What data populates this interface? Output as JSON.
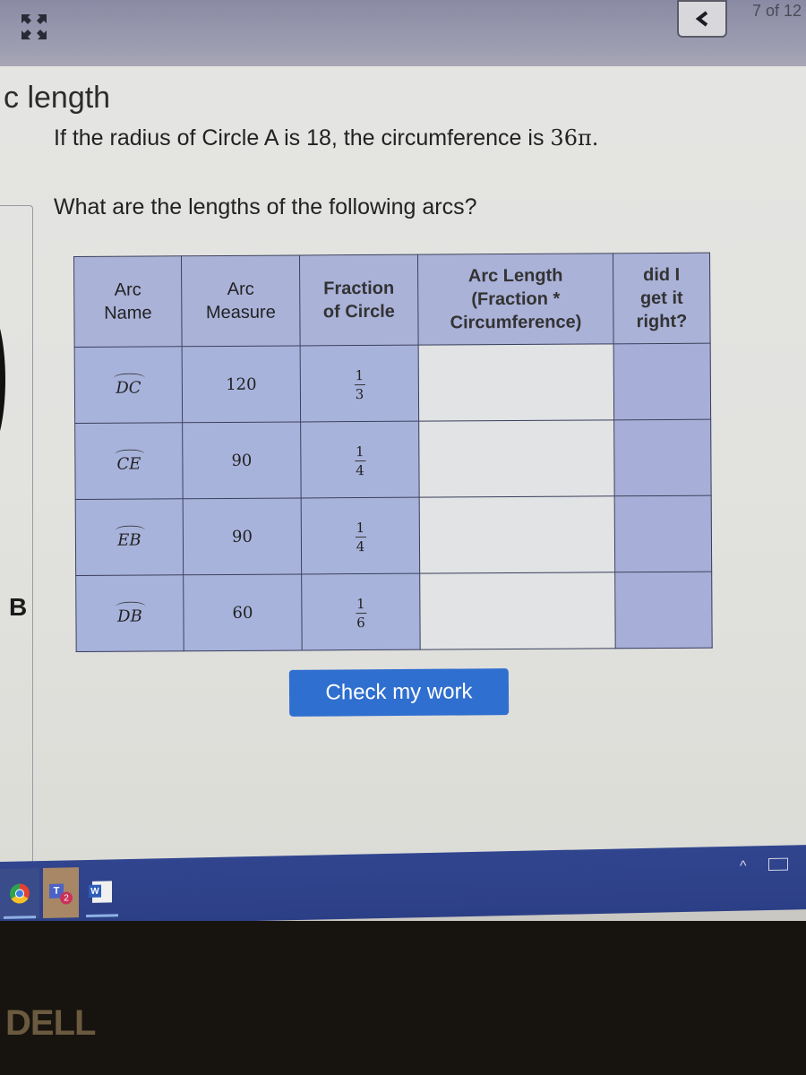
{
  "topbar": {
    "expand_icon": "expand-arrows-icon",
    "back_icon": "chevron-left-icon",
    "back_glyph": "‹",
    "page_counter": "7 of 12"
  },
  "page": {
    "title_fragment": "c length",
    "question_prefix": "If the radius of Circle A is 18, the circumference is ",
    "circumference_value": "36π.",
    "question2": "What are the lengths of the following arcs?",
    "side_label": "B"
  },
  "table": {
    "headers": [
      "Arc\nName",
      "Arc\nMeasure",
      "Fraction\nof Circle",
      "Arc Length\n(Fraction *\nCircumference)",
      "did I\nget it\nright?"
    ],
    "rows": [
      {
        "arc_name": "DC",
        "arc_measure": "120",
        "fraction_num": "1",
        "fraction_den": "3",
        "arc_length": "",
        "result": ""
      },
      {
        "arc_name": "CE",
        "arc_measure": "90",
        "fraction_num": "1",
        "fraction_den": "4",
        "arc_length": "",
        "result": ""
      },
      {
        "arc_name": "EB",
        "arc_measure": "90",
        "fraction_num": "1",
        "fraction_den": "4",
        "arc_length": "",
        "result": ""
      },
      {
        "arc_name": "DB",
        "arc_measure": "60",
        "fraction_num": "1",
        "fraction_den": "6",
        "arc_length": "",
        "result": ""
      }
    ]
  },
  "check_button_label": "Check my work",
  "taskbar": {
    "apps": [
      {
        "name": "chrome-icon"
      },
      {
        "name": "teams-icon",
        "letter": "T",
        "badge": "2"
      },
      {
        "name": "word-icon",
        "letter": "W"
      }
    ],
    "tray_chevron": "^"
  },
  "bezel": {
    "logo": "DELL"
  }
}
